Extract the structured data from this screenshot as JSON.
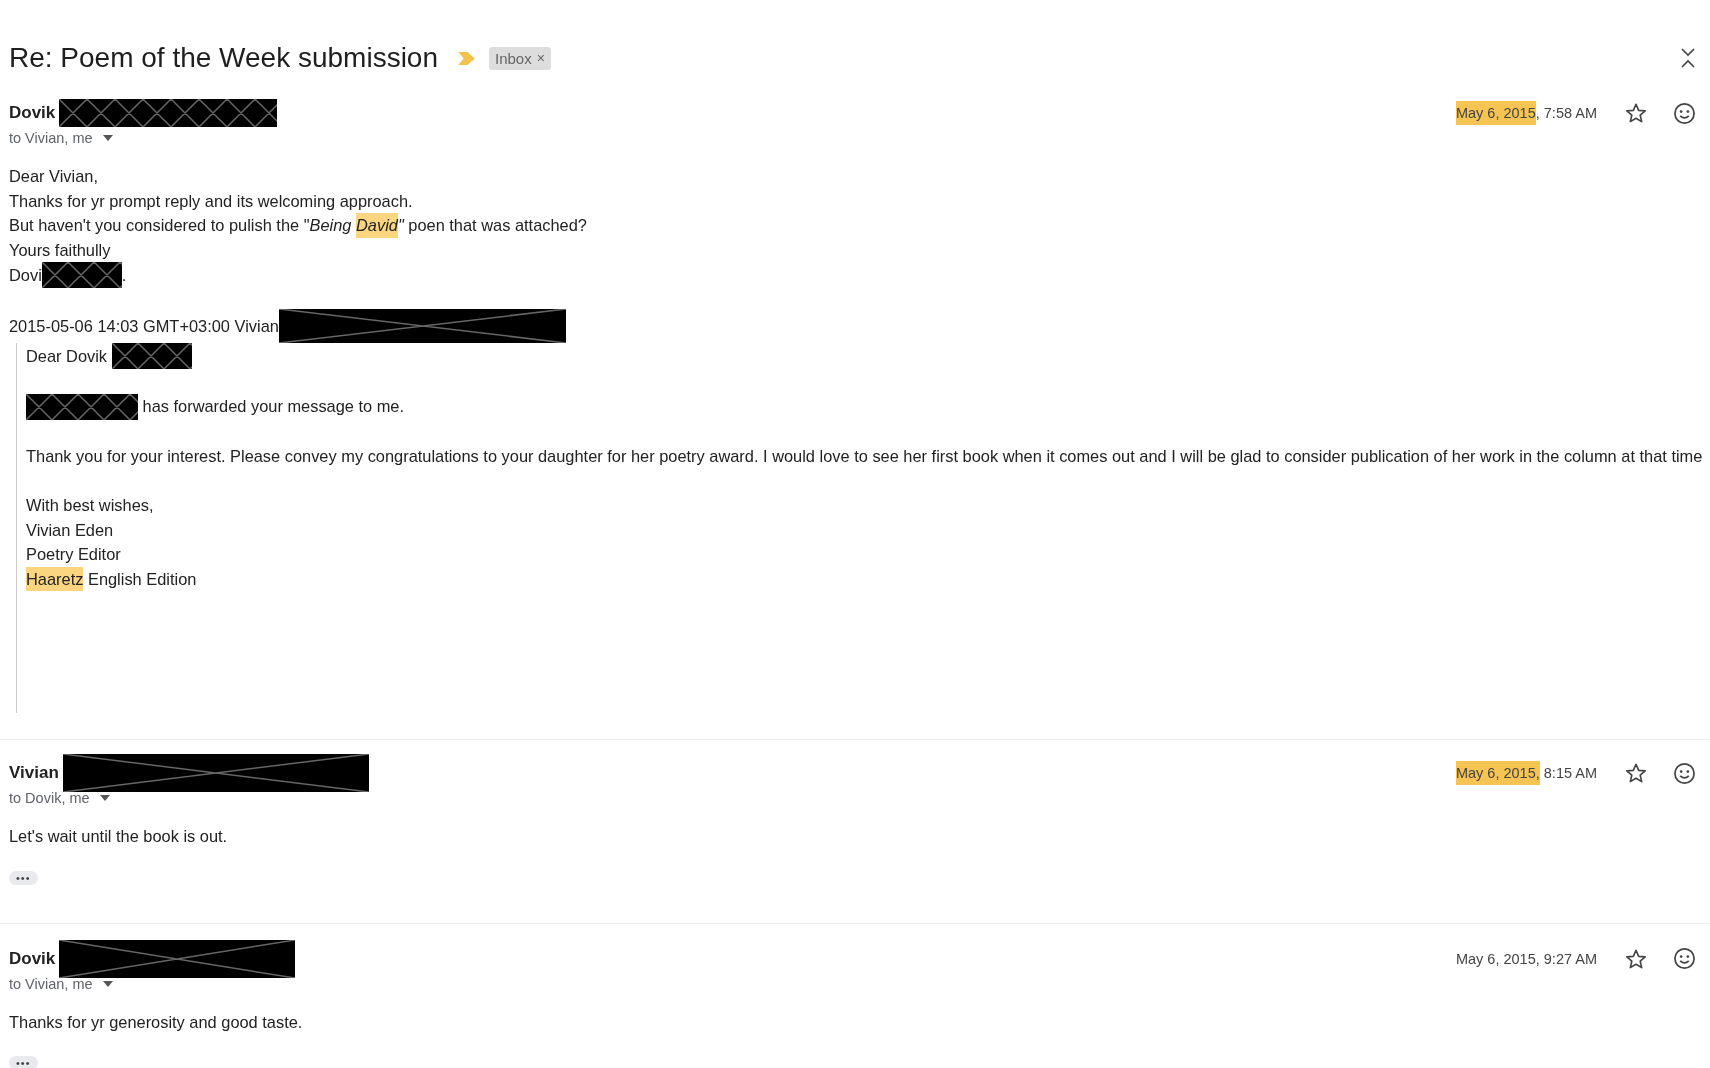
{
  "thread": {
    "subject": "Re: Poem of the Week submission",
    "importance_marker": true,
    "label": {
      "text": "Inbox",
      "remove": "×"
    }
  },
  "messages": [
    {
      "sender": "Dovik",
      "sender_redaction": {
        "lattice": true
      },
      "recipients": "to Vivian, me",
      "date": [
        {
          "text": "May 6, 2015",
          "kind": "highlight"
        },
        {
          "text": ", 7:58 AM",
          "kind": "plain"
        }
      ],
      "starred": false,
      "body": [
        [
          [
            {
              "text": "Dear Vivian,",
              "kind": "plain"
            }
          ],
          [
            {
              "text": "Thanks for yr prompt reply and its welcoming approach.",
              "kind": "plain"
            }
          ],
          [
            {
              "text": "But haven't you considered to pulish the \"",
              "kind": "plain"
            },
            {
              "text": "Being ",
              "kind": "italic"
            },
            {
              "text": "David",
              "kind": "italic-highlight"
            },
            {
              "text": "\"",
              "kind": "italic"
            },
            {
              "text": " poen that was attached?",
              "kind": "plain"
            }
          ],
          [
            {
              "text": "Yours faithully",
              "kind": "plain"
            }
          ],
          [
            {
              "text": "Dovi",
              "kind": "plain"
            },
            {
              "kind": "redaction",
              "lattice": true
            },
            {
              "text": ".",
              "kind": "plain"
            }
          ]
        ]
      ],
      "quote": {
        "attribution": [
          {
            "text": "2015-05-06 14:03 GMT+03:00 Vivian",
            "kind": "plain"
          },
          {
            "kind": "redaction",
            "lattice": false
          }
        ],
        "body": [
          [
            [
              {
                "text": "Dear Dovik ",
                "kind": "plain"
              },
              {
                "kind": "redaction",
                "lattice": true
              }
            ]
          ],
          [
            [
              {
                "kind": "redaction",
                "lattice": true
              },
              {
                "text": " has forwarded your message to me.",
                "kind": "plain"
              }
            ]
          ],
          [
            [
              {
                "text": "Thank you for your interest. Please convey my congratulations to your daughter for her poetry award. I would love to see her first book when it comes out and I will be glad to consider publication of her work in the column at that time",
                "kind": "plain"
              }
            ]
          ],
          [
            [
              {
                "text": "With best wishes,",
                "kind": "plain"
              }
            ],
            [
              {
                "text": "Vivian Eden",
                "kind": "plain"
              }
            ],
            [
              {
                "text": "Poetry Editor",
                "kind": "plain"
              }
            ],
            [
              {
                "text": "Haaretz",
                "kind": "highlight"
              },
              {
                "text": " English Edition",
                "kind": "plain"
              }
            ]
          ]
        ]
      }
    },
    {
      "sender": "Vivian",
      "sender_redaction": {
        "lattice": false
      },
      "recipients": "to Dovik, me",
      "date": [
        {
          "text": "May 6, 2015,",
          "kind": "highlight"
        },
        {
          "text": " 8:15 AM",
          "kind": "plain"
        }
      ],
      "starred": false,
      "body": [
        [
          [
            {
              "text": "Let's wait until the book is out.",
              "kind": "plain"
            }
          ]
        ]
      ],
      "trimmed": "•••"
    },
    {
      "sender": "Dovik",
      "sender_redaction": {
        "lattice": false
      },
      "recipients": "to Vivian, me",
      "date": [
        {
          "text": "May 6, 2015, 9:27 AM",
          "kind": "plain"
        }
      ],
      "starred": false,
      "body": [
        [
          [
            {
              "text": "Thanks for yr generosity and good taste.",
              "kind": "plain"
            }
          ]
        ]
      ],
      "trimmed": "•••"
    }
  ]
}
